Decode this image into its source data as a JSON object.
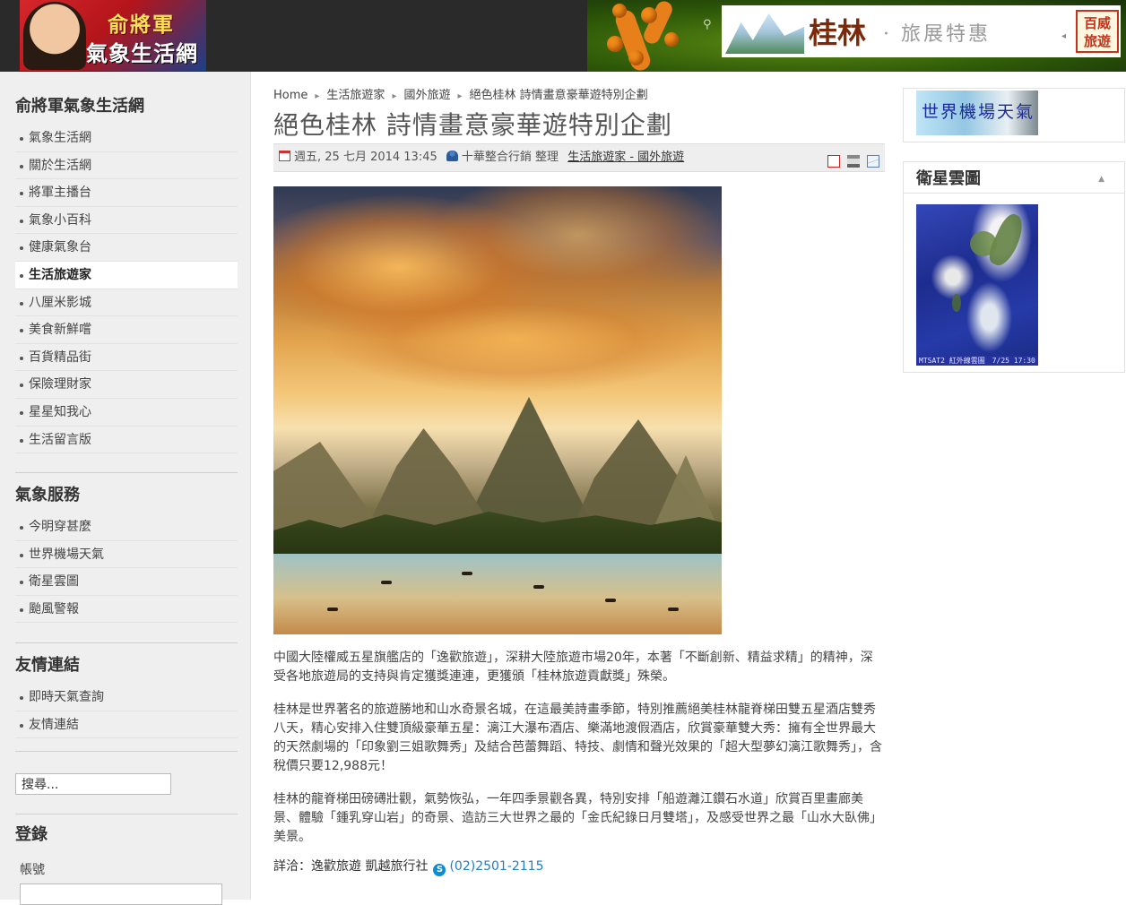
{
  "header": {
    "logo_line1": "俞將軍",
    "logo_line2": "氣象生活網",
    "banner_title": "桂林",
    "banner_subtitle": "· 旅展特惠",
    "banner_brand": "百威旅遊"
  },
  "sidebar": {
    "sections": [
      {
        "title": "俞將軍氣象生活網",
        "items": [
          "氣象生活網",
          "關於生活網",
          "將軍主播台",
          "氣象小百科",
          "健康氣象台",
          "生活旅遊家",
          "八厘米影城",
          "美食新鮮嚐",
          "百貨精品街",
          "保險理財家",
          "星星知我心",
          "生活留言版"
        ],
        "active_index": 5
      },
      {
        "title": "氣象服務",
        "items": [
          "今明穿甚麼",
          "世界機場天氣",
          "衛星雲圖",
          "颱風警報"
        ]
      },
      {
        "title": "友情連結",
        "items": [
          "即時天氣查詢",
          "友情連結"
        ]
      }
    ],
    "search_value": "搜尋...",
    "login_title": "登錄",
    "login_account_label": "帳號"
  },
  "article": {
    "breadcrumb": [
      "Home",
      "生活旅遊家",
      "國外旅遊",
      "絕色桂林 詩情畫意豪華遊特別企劃"
    ],
    "title": "絕色桂林 詩情畫意豪華遊特別企劃",
    "date": "週五, 25 七月 2014 13:45",
    "author": "十華整合行銷 整理",
    "category_parent": "生活旅遊家",
    "category_separator": " - ",
    "category_child": "國外旅遊",
    "paragraphs": [
      "中國大陸權威五星旗艦店的「逸歡旅遊」，深耕大陸旅遊市場20年，本著「不斷創新、精益求精」的精神，深受各地旅遊局的支持與肯定獲獎連連，更獲頒「桂林旅遊貢獻獎」殊榮。",
      "桂林是世界著名的旅遊勝地和山水奇景名城，在這最美詩畫季節，特別推薦絕美桂林龍脊梯田雙五星酒店雙秀八天，精心安排入住雙頂級豪華五星：漓江大瀑布酒店、樂滿地渡假酒店，欣賞豪華雙大秀：擁有全世界最大的天然劇場的「印象劉三姐歌舞秀」及結合芭蕾舞蹈、特技、劇情和聲光效果的「超大型夢幻漓江歌舞秀」，含稅價只要12,988元！",
      "桂林的龍脊梯田磅礡壯觀，氣勢恢弘，一年四季景觀各異，特別安排「船遊灕江鑽石水道」欣賞百里畫廊美景、體驗「鍾乳穿山岩」的奇景、造訪三大世界之最的「金氏紀錄日月雙塔」，及感受世界之最「山水大臥佛」美景。"
    ],
    "contact_label": "詳洽：逸歡旅遊 凱越旅行社",
    "contact_phone": "(02)2501-2115"
  },
  "right": {
    "airport_banner": "世界機場天氣",
    "satellite_title": "衛星雲圖",
    "satellite_caption": "MTSAT2 紅外線雲圖　7/25 17:30"
  }
}
